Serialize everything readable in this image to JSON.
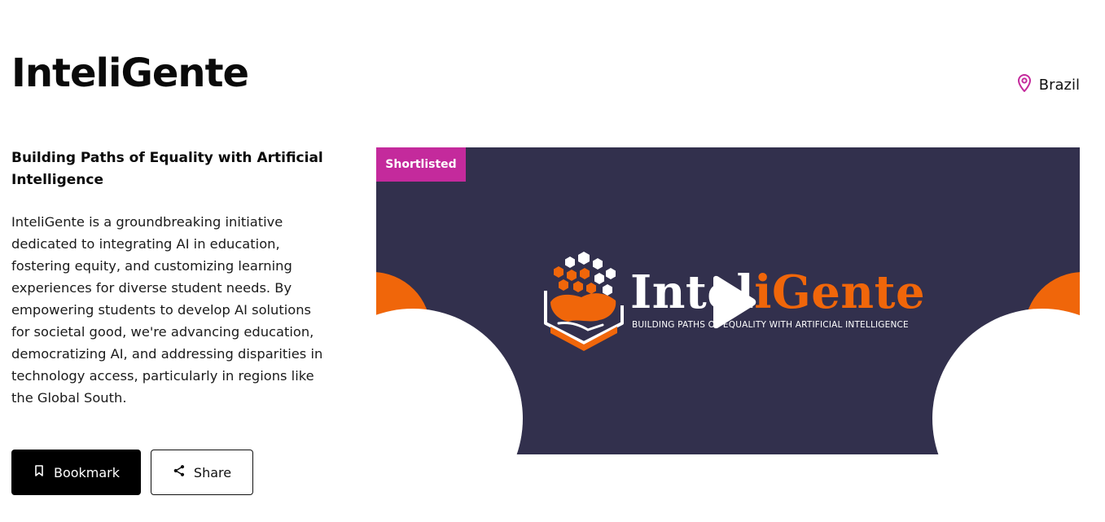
{
  "project": {
    "title": "InteliGente",
    "location": "Brazil",
    "subtitle": "Building Paths of Equality with Artificial Intelligence",
    "description": "InteliGente is a groundbreaking initiative dedicated to integrating AI in education, fostering equity, and customizing learning experiences for diverse student needs. By empowering students to develop AI solutions for societal good, we're advancing education, democratizing AI, and addressing disparities in technology access, particularly in regions like the Global South."
  },
  "actions": {
    "bookmark_label": "Bookmark",
    "share_label": "Share"
  },
  "video": {
    "badge": "Shortlisted",
    "logo_part1": "Intel",
    "logo_part2": "iGente",
    "tagline": "BUILDING PATHS OF EQUALITY WITH ARTIFICIAL INTELLIGENCE"
  },
  "icons": {
    "location": "map-pin-icon",
    "bookmark": "bookmark-icon",
    "share": "share-icon",
    "play": "play-icon"
  },
  "colors": {
    "accent_magenta": "#c42a9c",
    "video_background": "#32304d",
    "logo_orange": "#f0660a",
    "primary_button": "#000000"
  }
}
